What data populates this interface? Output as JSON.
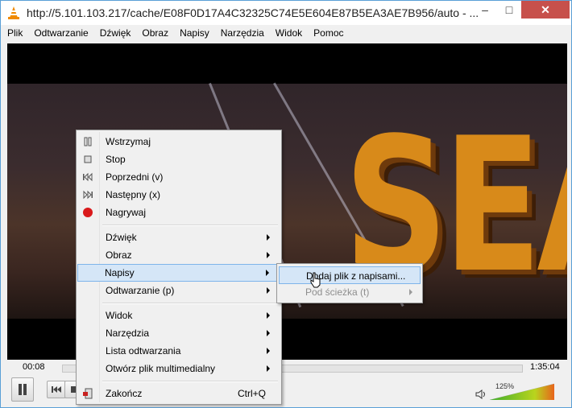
{
  "window": {
    "title": "http://5.101.103.217/cache/E08F0D17A4C32325C74E5E604E87B5EA3AE7B956/auto - ...",
    "minimize": "–",
    "maximize": "□",
    "close": "✕"
  },
  "menubar": [
    "Plik",
    "Odtwarzanie",
    "Dźwięk",
    "Obraz",
    "Napisy",
    "Narzędzia",
    "Widok",
    "Pomoc"
  ],
  "video": {
    "overlay_text": "SEA"
  },
  "player": {
    "elapsed": "00:08",
    "total": "1:35:04",
    "volume_label": "125%",
    "volume_level": 1.0
  },
  "context_menu": {
    "pause": {
      "label": "Wstrzymaj",
      "icon": "pause-icon"
    },
    "stop": {
      "label": "Stop",
      "icon": "stop-icon"
    },
    "previous": {
      "label": "Poprzedni (v)",
      "icon": "previous-icon"
    },
    "next": {
      "label": "Następny (x)",
      "icon": "next-icon"
    },
    "record": {
      "label": "Nagrywaj",
      "icon": "record-icon",
      "color": "#d9191b"
    },
    "audio": {
      "label": "Dźwięk"
    },
    "video": {
      "label": "Obraz"
    },
    "subtitles": {
      "label": "Napisy"
    },
    "playback": {
      "label": "Odtwarzanie (p)"
    },
    "view": {
      "label": "Widok"
    },
    "tools": {
      "label": "Narzędzia"
    },
    "playlist": {
      "label": "Lista odtwarzania"
    },
    "open_media": {
      "label": "Otwórz plik multimedialny"
    },
    "quit": {
      "label": "Zakończ",
      "shortcut": "Ctrl+Q",
      "icon": "quit-icon"
    }
  },
  "subtitles_submenu": {
    "add_file": {
      "label": "Dodaj plik z napisami..."
    },
    "sub_track": {
      "label": "Pod ścieżka (t)"
    }
  },
  "colors": {
    "highlight": "#d5e6f7",
    "highlight_border": "#7eb4ea",
    "close_button": "#c7504b",
    "vlc_orange": "#f08a00"
  }
}
